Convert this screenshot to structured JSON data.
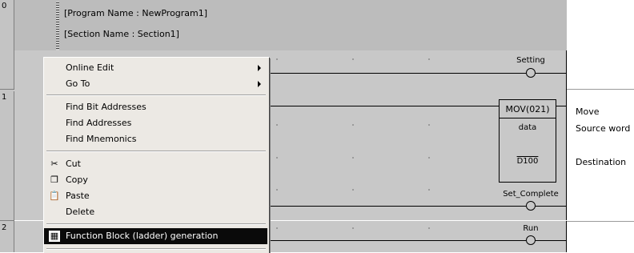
{
  "rows": [
    {
      "number": "0",
      "step": "0"
    },
    {
      "number": "1"
    },
    {
      "number": "2"
    }
  ],
  "header": {
    "program_name": "[Program Name : NewProgram1]",
    "section_name": "[Section Name : Section1]"
  },
  "coils": {
    "setting": "Setting",
    "set_complete": "Set_Complete",
    "run": "Run"
  },
  "instruction": {
    "name": "MOV(021)",
    "operand1": "data",
    "operand2": "D100",
    "comment_name": "Move",
    "comment_op1": "Source word",
    "comment_op2": "Destination"
  },
  "menu": {
    "items": [
      {
        "label": "Online Edit",
        "icon": ""
      },
      {
        "label": "Go To",
        "icon": ""
      },
      {
        "label": "Find Bit Addresses",
        "icon": ""
      },
      {
        "label": "Find Addresses",
        "icon": ""
      },
      {
        "label": "Find Mnemonics",
        "icon": ""
      },
      {
        "label": "Cut",
        "icon": "scissors-icon"
      },
      {
        "label": "Copy",
        "icon": "copy-icon"
      },
      {
        "label": "Paste",
        "icon": "paste-icon"
      },
      {
        "label": "Delete",
        "icon": ""
      },
      {
        "label": "Function Block (ladder) generation",
        "icon": "function-block-icon"
      }
    ],
    "highlight_color": "#0a0a0a"
  }
}
